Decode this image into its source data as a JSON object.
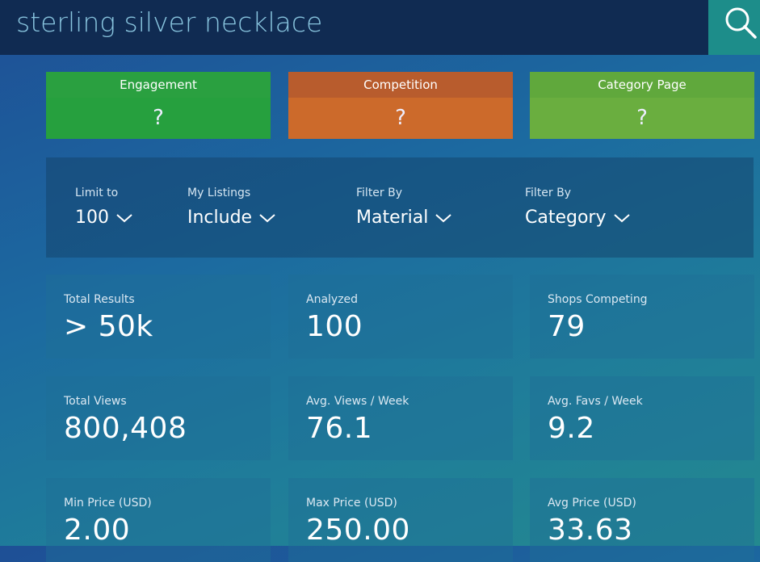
{
  "search": {
    "query": "sterling silver necklace"
  },
  "scores": [
    {
      "label": "Engagement",
      "value": "?"
    },
    {
      "label": "Competition",
      "value": "?"
    },
    {
      "label": "Category Page",
      "value": "?"
    }
  ],
  "filters": {
    "limit": {
      "label": "Limit to",
      "value": "100"
    },
    "listings": {
      "label": "My Listings",
      "value": "Include"
    },
    "material": {
      "label": "Filter By",
      "value": "Material"
    },
    "category": {
      "label": "Filter By",
      "value": "Category"
    }
  },
  "stats": [
    {
      "label": "Total Results",
      "value": "> 50k"
    },
    {
      "label": "Analyzed",
      "value": "100"
    },
    {
      "label": "Shops Competing",
      "value": "79"
    },
    {
      "label": "Total Views",
      "value": "800,408"
    },
    {
      "label": "Avg. Views / Week",
      "value": "76.1"
    },
    {
      "label": "Avg. Favs / Week",
      "value": "9.2"
    },
    {
      "label": "Min Price (USD)",
      "value": "2.00"
    },
    {
      "label": "Max Price (USD)",
      "value": "250.00"
    },
    {
      "label": "Avg Price (USD)",
      "value": "33.63"
    }
  ],
  "colors": {
    "header": "#102b52",
    "search_button": "#1d8d8a",
    "engagement": "#26a03e",
    "competition": "#cc6a2b",
    "category": "#6aae3f"
  }
}
